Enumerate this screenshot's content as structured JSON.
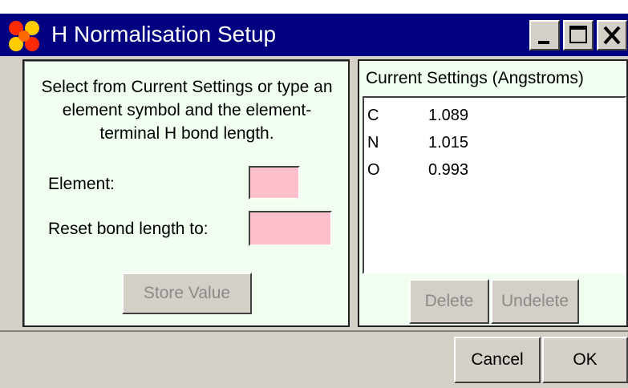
{
  "window": {
    "title": "H Normalisation Setup",
    "app_icon": "molecule-logo-icon",
    "controls": [
      "minimize-icon",
      "maximize-icon",
      "close-icon"
    ]
  },
  "left_panel": {
    "instructions": "Select from Current Settings or type an element symbol and the element-terminal H bond length.",
    "element_label": "Element:",
    "element_value": "",
    "reset_label": "Reset bond length to:",
    "reset_value": "",
    "store_button": "Store Value"
  },
  "right_panel": {
    "title": "Current Settings (Angstroms)",
    "items": [
      {
        "element": "C",
        "length": "1.089"
      },
      {
        "element": "N",
        "length": "1.015"
      },
      {
        "element": "O",
        "length": "0.993"
      }
    ],
    "delete_button": "Delete",
    "undelete_button": "Undelete"
  },
  "footer": {
    "cancel_button": "Cancel",
    "ok_button": "OK"
  },
  "colors": {
    "titlebar": "#000080",
    "panel_bg": "#f0fff0",
    "input_bg": "#ffc0cb",
    "chrome": "#d4d0c8"
  }
}
